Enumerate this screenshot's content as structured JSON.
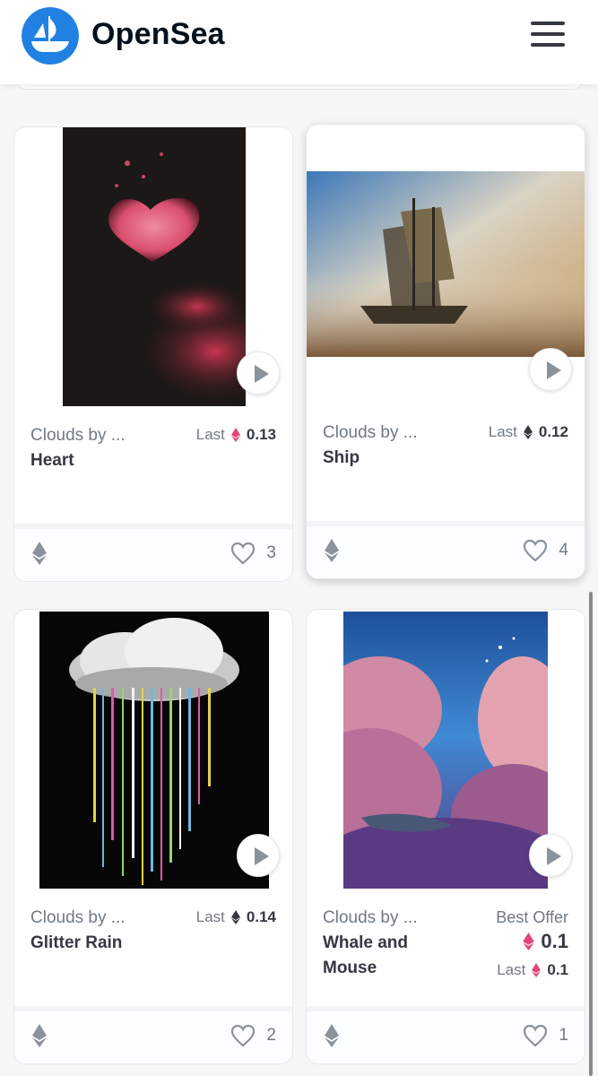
{
  "header": {
    "brand": "OpenSea",
    "menu_icon": "hamburger-menu-icon"
  },
  "colors": {
    "brand_blue": "#2081e2",
    "eth_pink": "#e2457c",
    "eth_dark": "#353840",
    "muted": "#707a83"
  },
  "cards": [
    {
      "collection": "Clouds by ...",
      "title": "Heart",
      "price_label": "Last",
      "price_value": "0.13",
      "price_eth_color": "#e2457c",
      "likes": "3"
    },
    {
      "collection": "Clouds by ...",
      "title": "Ship",
      "price_label": "Last",
      "price_value": "0.12",
      "price_eth_color": "#353840",
      "likes": "4"
    },
    {
      "collection": "Clouds by ...",
      "title": "Glitter Rain",
      "price_label": "Last",
      "price_value": "0.14",
      "price_eth_color": "#353840",
      "likes": "2"
    },
    {
      "collection": "Clouds by ...",
      "title_line1": "Whale and",
      "title_line2": "Mouse",
      "offer_label": "Best Offer",
      "offer_value": "0.1",
      "price_label": "Last",
      "price_value": "0.1",
      "price_eth_color": "#e2457c",
      "likes": "1"
    }
  ]
}
